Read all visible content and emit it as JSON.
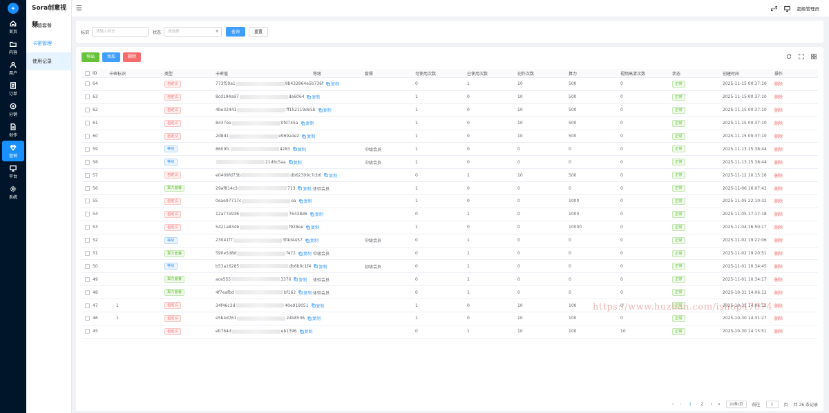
{
  "rail": {
    "items": [
      {
        "label": "首页",
        "icon": "home-icon"
      },
      {
        "label": "内容",
        "icon": "folder-icon"
      },
      {
        "label": "用户",
        "icon": "user-icon"
      },
      {
        "label": "订单",
        "icon": "order-icon"
      },
      {
        "label": "分销",
        "icon": "share-icon"
      },
      {
        "label": "创作",
        "icon": "document-icon"
      },
      {
        "label": "营销",
        "icon": "diamond-icon"
      },
      {
        "label": "平台",
        "icon": "monitor-icon"
      },
      {
        "label": "系统",
        "icon": "gear-icon"
      }
    ]
  },
  "submenu": {
    "title": "Sora创意视频",
    "items": [
      "充值套餐",
      "卡密管理",
      "使用记录"
    ]
  },
  "topbar": {
    "user": "超级管理员"
  },
  "filter": {
    "label_id": "标识",
    "placeholder_id": "请输入标识",
    "label_status": "状态",
    "placeholder_status": "请选择",
    "search": "查询",
    "reset": "重置"
  },
  "toolbar": {
    "export": "导出",
    "add": "添加",
    "delete": "删除"
  },
  "table": {
    "headers": [
      "ID",
      "卡密标识",
      "类型",
      "卡密值",
      "等级",
      "套餐",
      "可使用次数",
      "已使用次数",
      "创作次数",
      "算力",
      "视频高清次数",
      "状态",
      "创建时间",
      "操作"
    ],
    "status_ok": "正常",
    "action_delete": "删除",
    "copy_label": "复制",
    "rows": [
      {
        "id": "64",
        "mark": "",
        "type": "自定义",
        "tt": "custom",
        "vh": "773f59a1",
        "vt": "9b432864e5b736f",
        "level": "",
        "pkg": "",
        "avail": "0",
        "used": "1",
        "create": "10",
        "compute": "500",
        "hd": "0",
        "time": "2025-11-15 00:37:10"
      },
      {
        "id": "63",
        "mark": "",
        "type": "自定义",
        "tt": "custom",
        "vh": "8cd194a97",
        "vt": "da6064",
        "level": "",
        "pkg": "",
        "avail": "1",
        "used": "0",
        "create": "10",
        "compute": "500",
        "hd": "0",
        "time": "2025-11-15 00:37:10"
      },
      {
        "id": "62",
        "mark": "",
        "type": "自定义",
        "tt": "custom",
        "vh": "4be32441",
        "vt": "ff152119de5b",
        "level": "",
        "pkg": "",
        "avail": "1",
        "used": "0",
        "create": "10",
        "compute": "500",
        "hd": "0",
        "time": "2025-11-15 00:37:10"
      },
      {
        "id": "61",
        "mark": "",
        "type": "自定义",
        "tt": "custom",
        "vh": "8437ee",
        "vt": "0fd745a",
        "level": "",
        "pkg": "",
        "avail": "1",
        "used": "0",
        "create": "10",
        "compute": "500",
        "hd": "0",
        "time": "2025-11-15 00:37:10"
      },
      {
        "id": "60",
        "mark": "",
        "type": "自定义",
        "tt": "custom",
        "vh": "2d8d1",
        "vt": "e969a4e2",
        "level": "",
        "pkg": "",
        "avail": "1",
        "used": "0",
        "create": "10",
        "compute": "500",
        "hd": "0",
        "time": "2025-11-15 00:37:10"
      },
      {
        "id": "59",
        "mark": "",
        "type": "等级",
        "tt": "level",
        "vh": "8609fc",
        "vt": "4283",
        "level": "中级会员",
        "pkg": "",
        "avail": "1",
        "used": "0",
        "create": "0",
        "compute": "0",
        "hd": "0",
        "time": "2025-11-13 15:38:44"
      },
      {
        "id": "58",
        "mark": "",
        "type": "等级",
        "tt": "level",
        "vh": "",
        "vt": "21d6c5aa",
        "level": "中级会员",
        "pkg": "",
        "avail": "1",
        "used": "0",
        "create": "0",
        "compute": "0",
        "hd": "0",
        "time": "2025-11-13 15:38:44"
      },
      {
        "id": "57",
        "mark": "",
        "type": "自定义",
        "tt": "custom",
        "vh": "e0409fd73b",
        "vt": "db62309c7cb6",
        "level": "",
        "pkg": "",
        "avail": "0",
        "used": "1",
        "create": "10",
        "compute": "500",
        "hd": "0",
        "time": "2025-11-12 10:15:16"
      },
      {
        "id": "56",
        "mark": "",
        "type": "算力套餐",
        "tt": "compute",
        "vh": "29af814c3",
        "vt": "713",
        "level": "",
        "pkg": "体验会员",
        "avail": "1",
        "used": "0",
        "create": "0",
        "compute": "0",
        "hd": "0",
        "time": "2025-11-06 16:07:42"
      },
      {
        "id": "55",
        "mark": "",
        "type": "自定义",
        "tt": "custom",
        "vh": "0eae97717c",
        "vt": "oa",
        "level": "",
        "pkg": "",
        "avail": "1",
        "used": "0",
        "create": "0",
        "compute": "1000",
        "hd": "0",
        "time": "2025-11-05 22:10:32"
      },
      {
        "id": "54",
        "mark": "",
        "type": "自定义",
        "tt": "custom",
        "vh": "12a77e936",
        "vt": "76438d6",
        "level": "",
        "pkg": "",
        "avail": "0",
        "used": "1",
        "create": "0",
        "compute": "1000",
        "hd": "0",
        "time": "2025-11-05 17:17:18"
      },
      {
        "id": "53",
        "mark": "",
        "type": "自定义",
        "tt": "custom",
        "vh": "5421a834b",
        "vt": "f928ee",
        "level": "",
        "pkg": "",
        "avail": "1",
        "used": "0",
        "create": "0",
        "compute": "10000",
        "hd": "0",
        "time": "2025-11-04 16:50:17"
      },
      {
        "id": "52",
        "mark": "",
        "type": "等级",
        "tt": "level",
        "vh": "23041f7",
        "vt": "3f4d4457",
        "level": "中级会员",
        "pkg": "",
        "avail": "0",
        "used": "1",
        "create": "0",
        "compute": "0",
        "hd": "0",
        "time": "2025-11-02 19:22:06"
      },
      {
        "id": "51",
        "mark": "",
        "type": "算力套餐",
        "tt": "compute",
        "vh": "590e5d8d",
        "vt": "f472",
        "level": "",
        "pkg": "中级会员",
        "avail": "0",
        "used": "1",
        "create": "0",
        "compute": "0",
        "hd": "0",
        "time": "2025-11-02 19:20:51"
      },
      {
        "id": "50",
        "mark": "",
        "type": "等级",
        "tt": "level",
        "vh": "b53a16285",
        "vt": "db6b0c1f4",
        "level": "初级会员",
        "pkg": "",
        "avail": "0",
        "used": "1",
        "create": "0",
        "compute": "0",
        "hd": "0",
        "time": "2025-11-01 10:34:45"
      },
      {
        "id": "49",
        "mark": "",
        "type": "算力套餐",
        "tt": "compute",
        "vh": "ace555",
        "vt": "3376",
        "level": "",
        "pkg": "体验会员",
        "avail": "0",
        "used": "1",
        "create": "0",
        "compute": "0",
        "hd": "0",
        "time": "2025-11-01 10:34:17"
      },
      {
        "id": "48",
        "mark": "",
        "type": "算力套餐",
        "tt": "compute",
        "vh": "4f7eafbd",
        "vt": "bf162",
        "level": "",
        "pkg": "体验会员",
        "avail": "0",
        "used": "1",
        "create": "0",
        "compute": "0",
        "hd": "0",
        "time": "2025-10-31 14:06:12"
      },
      {
        "id": "47",
        "mark": "1",
        "type": "自定义",
        "tt": "custom",
        "vh": "34f46c3d",
        "vt": "40e919051",
        "level": "",
        "pkg": "",
        "avail": "1",
        "used": "0",
        "create": "10",
        "compute": "100",
        "hd": "0",
        "time": "2025-10-31 14:06:12"
      },
      {
        "id": "46",
        "mark": "1",
        "type": "自定义",
        "tt": "custom",
        "vh": "e5b4d761",
        "vt": "24b8506",
        "level": "",
        "pkg": "",
        "avail": "1",
        "used": "0",
        "create": "10",
        "compute": "100",
        "hd": "0",
        "time": "2025-10-30 14:31:27"
      },
      {
        "id": "45",
        "mark": "",
        "type": "自定义",
        "tt": "custom",
        "vh": "eb764d",
        "vt": "eb1396",
        "level": "",
        "pkg": "",
        "avail": "0",
        "used": "1",
        "create": "10",
        "compute": "100",
        "hd": "10",
        "time": "2025-10-30 14:15:51"
      }
    ]
  },
  "pagination": {
    "page1": "1",
    "page2": "2",
    "page_size": "20条/页",
    "goto_label": "前往",
    "goto_value": "1",
    "page_unit": "页",
    "total": "共 26 条记录"
  },
  "watermark": "https://www.huzhan.com/ishop47874"
}
